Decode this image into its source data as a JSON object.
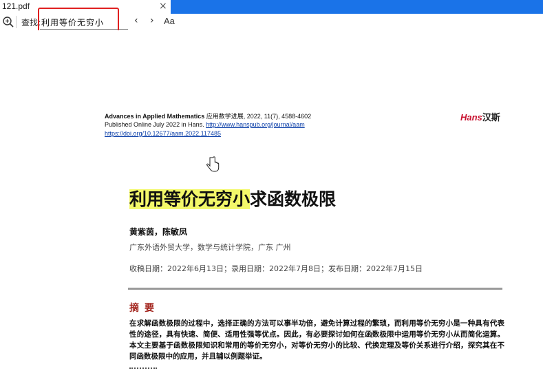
{
  "tab": {
    "title": "121.pdf",
    "close_glyph": "×"
  },
  "findbar": {
    "label": "查找:",
    "query": "利用等价无穷小",
    "prev_glyph": "‹",
    "next_glyph": "›",
    "match_case_label": "Aa"
  },
  "colors": {
    "accent": "#1a73e8",
    "highlight": "#f3f86a",
    "annotation_box": "#e02020",
    "abstract_heading": "#a3261f"
  },
  "document": {
    "journal_en": "Advances in Applied Mathematics",
    "journal_cn": "应用数学进展, 2022, 11(7), 4588-4602",
    "published": "Published Online July 2022 in Hans.",
    "journal_url": "http://www.hanspub.org/journal/aam",
    "doi": "https://doi.org/10.12677/aam.2022.117485",
    "logo_en": "Hans",
    "logo_cn": "汉斯",
    "title_highlight": "利用等价无穷小",
    "title_rest": "求函数极限",
    "authors": "黄紫茵，陈敏凤",
    "affiliation": "广东外语外贸大学，数学与统计学院，广东 广州",
    "dates": "收稿日期：2022年6月13日；录用日期：2022年7月8日；发布日期：2022年7月15日",
    "abstract_heading": "摘要",
    "abstract_body": "在求解函数极限的过程中，选择正确的方法可以事半功倍，避免计算过程的繁琐，而利用等价无穷小是一种具有代表性的途径，具有快速、简便、适用性强等优点。因此，有必要探讨如何在函数极限中运用等价无穷小从而简化运算。本文主要基于函数极限知识和常用的等价无穷小，对等价无穷小的比较、代换定理及等价关系进行介绍，探究其在不同函数极限中的应用，并且辅以例题举证。"
  }
}
